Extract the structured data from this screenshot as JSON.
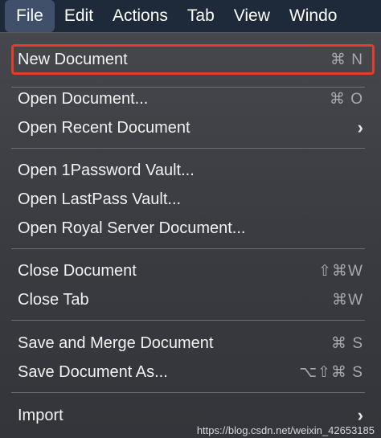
{
  "menubar": {
    "items": [
      {
        "label": "File",
        "active": true
      },
      {
        "label": "Edit"
      },
      {
        "label": "Actions"
      },
      {
        "label": "Tab"
      },
      {
        "label": "View"
      },
      {
        "label": "Windo"
      }
    ]
  },
  "menu": {
    "new_document": {
      "label": "New Document",
      "shortcut": "⌘ N"
    },
    "open_document": {
      "label": "Open Document...",
      "shortcut": "⌘ O"
    },
    "open_recent": {
      "label": "Open Recent Document",
      "submenu": "›"
    },
    "open_1password": {
      "label": "Open 1Password Vault..."
    },
    "open_lastpass": {
      "label": "Open LastPass Vault..."
    },
    "open_royal": {
      "label": "Open Royal Server Document..."
    },
    "close_document": {
      "label": "Close Document",
      "shortcut": "⇧⌘W"
    },
    "close_tab": {
      "label": "Close Tab",
      "shortcut": "⌘W"
    },
    "save_merge": {
      "label": "Save and Merge Document",
      "shortcut": "⌘ S"
    },
    "save_as": {
      "label": "Save Document As...",
      "shortcut": "⌥⇧⌘ S"
    },
    "import": {
      "label": "Import",
      "submenu": "›"
    }
  },
  "colors": {
    "highlight_border": "#e53a2e",
    "menubar_bg": "#1e2a3a",
    "active_menu_bg": "#40506a"
  },
  "watermark": "https://blog.csdn.net/weixin_42653185"
}
